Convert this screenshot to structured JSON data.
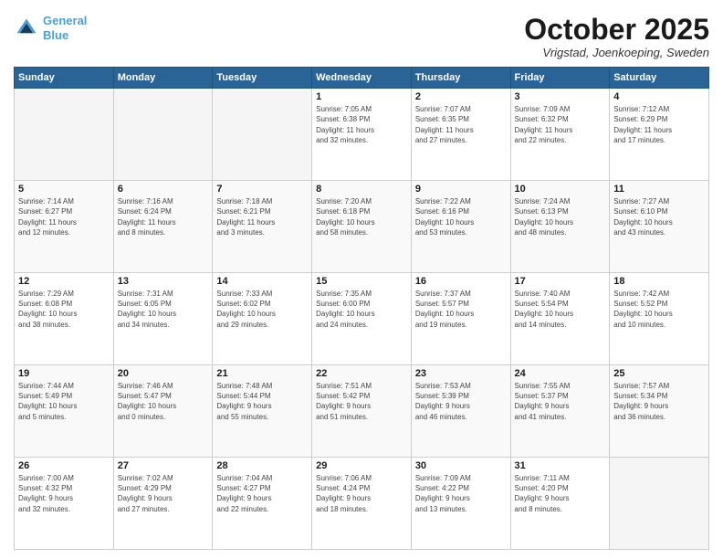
{
  "header": {
    "logo_line1": "General",
    "logo_line2": "Blue",
    "month": "October 2025",
    "location": "Vrigstad, Joenkoeping, Sweden"
  },
  "weekdays": [
    "Sunday",
    "Monday",
    "Tuesday",
    "Wednesday",
    "Thursday",
    "Friday",
    "Saturday"
  ],
  "weeks": [
    [
      {
        "day": "",
        "info": ""
      },
      {
        "day": "",
        "info": ""
      },
      {
        "day": "",
        "info": ""
      },
      {
        "day": "1",
        "info": "Sunrise: 7:05 AM\nSunset: 6:38 PM\nDaylight: 11 hours\nand 32 minutes."
      },
      {
        "day": "2",
        "info": "Sunrise: 7:07 AM\nSunset: 6:35 PM\nDaylight: 11 hours\nand 27 minutes."
      },
      {
        "day": "3",
        "info": "Sunrise: 7:09 AM\nSunset: 6:32 PM\nDaylight: 11 hours\nand 22 minutes."
      },
      {
        "day": "4",
        "info": "Sunrise: 7:12 AM\nSunset: 6:29 PM\nDaylight: 11 hours\nand 17 minutes."
      }
    ],
    [
      {
        "day": "5",
        "info": "Sunrise: 7:14 AM\nSunset: 6:27 PM\nDaylight: 11 hours\nand 12 minutes."
      },
      {
        "day": "6",
        "info": "Sunrise: 7:16 AM\nSunset: 6:24 PM\nDaylight: 11 hours\nand 8 minutes."
      },
      {
        "day": "7",
        "info": "Sunrise: 7:18 AM\nSunset: 6:21 PM\nDaylight: 11 hours\nand 3 minutes."
      },
      {
        "day": "8",
        "info": "Sunrise: 7:20 AM\nSunset: 6:18 PM\nDaylight: 10 hours\nand 58 minutes."
      },
      {
        "day": "9",
        "info": "Sunrise: 7:22 AM\nSunset: 6:16 PM\nDaylight: 10 hours\nand 53 minutes."
      },
      {
        "day": "10",
        "info": "Sunrise: 7:24 AM\nSunset: 6:13 PM\nDaylight: 10 hours\nand 48 minutes."
      },
      {
        "day": "11",
        "info": "Sunrise: 7:27 AM\nSunset: 6:10 PM\nDaylight: 10 hours\nand 43 minutes."
      }
    ],
    [
      {
        "day": "12",
        "info": "Sunrise: 7:29 AM\nSunset: 6:08 PM\nDaylight: 10 hours\nand 38 minutes."
      },
      {
        "day": "13",
        "info": "Sunrise: 7:31 AM\nSunset: 6:05 PM\nDaylight: 10 hours\nand 34 minutes."
      },
      {
        "day": "14",
        "info": "Sunrise: 7:33 AM\nSunset: 6:02 PM\nDaylight: 10 hours\nand 29 minutes."
      },
      {
        "day": "15",
        "info": "Sunrise: 7:35 AM\nSunset: 6:00 PM\nDaylight: 10 hours\nand 24 minutes."
      },
      {
        "day": "16",
        "info": "Sunrise: 7:37 AM\nSunset: 5:57 PM\nDaylight: 10 hours\nand 19 minutes."
      },
      {
        "day": "17",
        "info": "Sunrise: 7:40 AM\nSunset: 5:54 PM\nDaylight: 10 hours\nand 14 minutes."
      },
      {
        "day": "18",
        "info": "Sunrise: 7:42 AM\nSunset: 5:52 PM\nDaylight: 10 hours\nand 10 minutes."
      }
    ],
    [
      {
        "day": "19",
        "info": "Sunrise: 7:44 AM\nSunset: 5:49 PM\nDaylight: 10 hours\nand 5 minutes."
      },
      {
        "day": "20",
        "info": "Sunrise: 7:46 AM\nSunset: 5:47 PM\nDaylight: 10 hours\nand 0 minutes."
      },
      {
        "day": "21",
        "info": "Sunrise: 7:48 AM\nSunset: 5:44 PM\nDaylight: 9 hours\nand 55 minutes."
      },
      {
        "day": "22",
        "info": "Sunrise: 7:51 AM\nSunset: 5:42 PM\nDaylight: 9 hours\nand 51 minutes."
      },
      {
        "day": "23",
        "info": "Sunrise: 7:53 AM\nSunset: 5:39 PM\nDaylight: 9 hours\nand 46 minutes."
      },
      {
        "day": "24",
        "info": "Sunrise: 7:55 AM\nSunset: 5:37 PM\nDaylight: 9 hours\nand 41 minutes."
      },
      {
        "day": "25",
        "info": "Sunrise: 7:57 AM\nSunset: 5:34 PM\nDaylight: 9 hours\nand 36 minutes."
      }
    ],
    [
      {
        "day": "26",
        "info": "Sunrise: 7:00 AM\nSunset: 4:32 PM\nDaylight: 9 hours\nand 32 minutes."
      },
      {
        "day": "27",
        "info": "Sunrise: 7:02 AM\nSunset: 4:29 PM\nDaylight: 9 hours\nand 27 minutes."
      },
      {
        "day": "28",
        "info": "Sunrise: 7:04 AM\nSunset: 4:27 PM\nDaylight: 9 hours\nand 22 minutes."
      },
      {
        "day": "29",
        "info": "Sunrise: 7:06 AM\nSunset: 4:24 PM\nDaylight: 9 hours\nand 18 minutes."
      },
      {
        "day": "30",
        "info": "Sunrise: 7:09 AM\nSunset: 4:22 PM\nDaylight: 9 hours\nand 13 minutes."
      },
      {
        "day": "31",
        "info": "Sunrise: 7:11 AM\nSunset: 4:20 PM\nDaylight: 9 hours\nand 8 minutes."
      },
      {
        "day": "",
        "info": ""
      }
    ]
  ]
}
